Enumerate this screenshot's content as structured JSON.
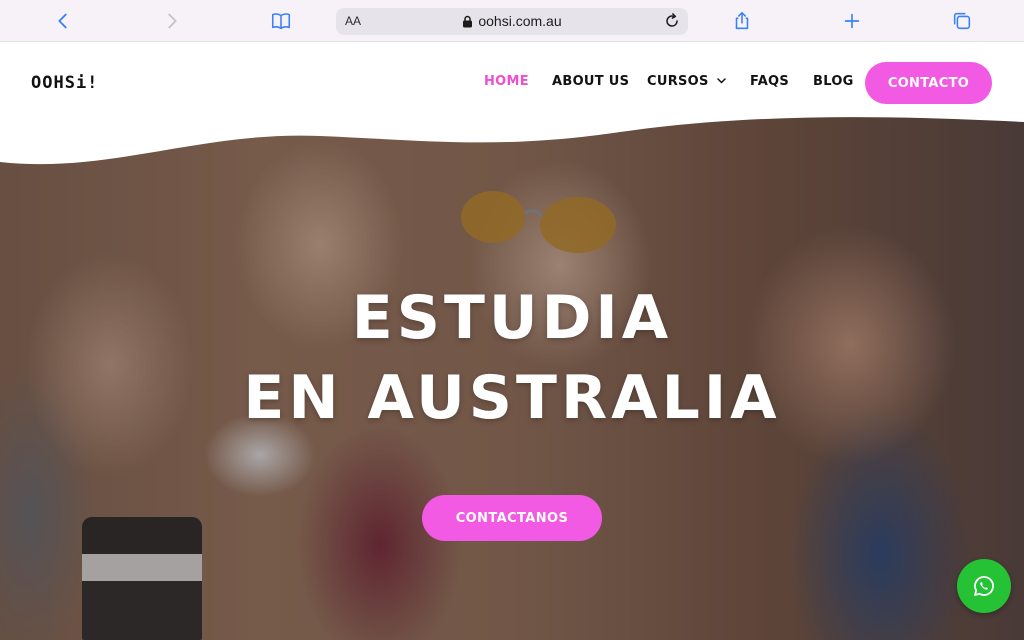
{
  "browser": {
    "text_size_label": "AA",
    "url": "oohsi.com.au",
    "icons": [
      "back-icon",
      "forward-icon",
      "bookmarks-icon",
      "lock-icon",
      "reload-icon",
      "share-icon",
      "new-tab-icon",
      "tabs-icon"
    ]
  },
  "site": {
    "logo": "OOHSi!",
    "nav": {
      "home": "HOME",
      "about": "ABOUT US",
      "cursos": "CURSOS",
      "faqs": "FAQS",
      "blog": "BLOG",
      "contacto": "CONTACTO"
    },
    "accent_color": "#f25ae3",
    "active_nav_color": "#ee4fd0"
  },
  "hero": {
    "title_line1": "ESTUDIA",
    "title_line2": "EN AUSTRALIA",
    "cta": "CONTACTANOS"
  },
  "widgets": {
    "whatsapp_icon": "whatsapp-icon",
    "whatsapp_color": "#25c236"
  }
}
